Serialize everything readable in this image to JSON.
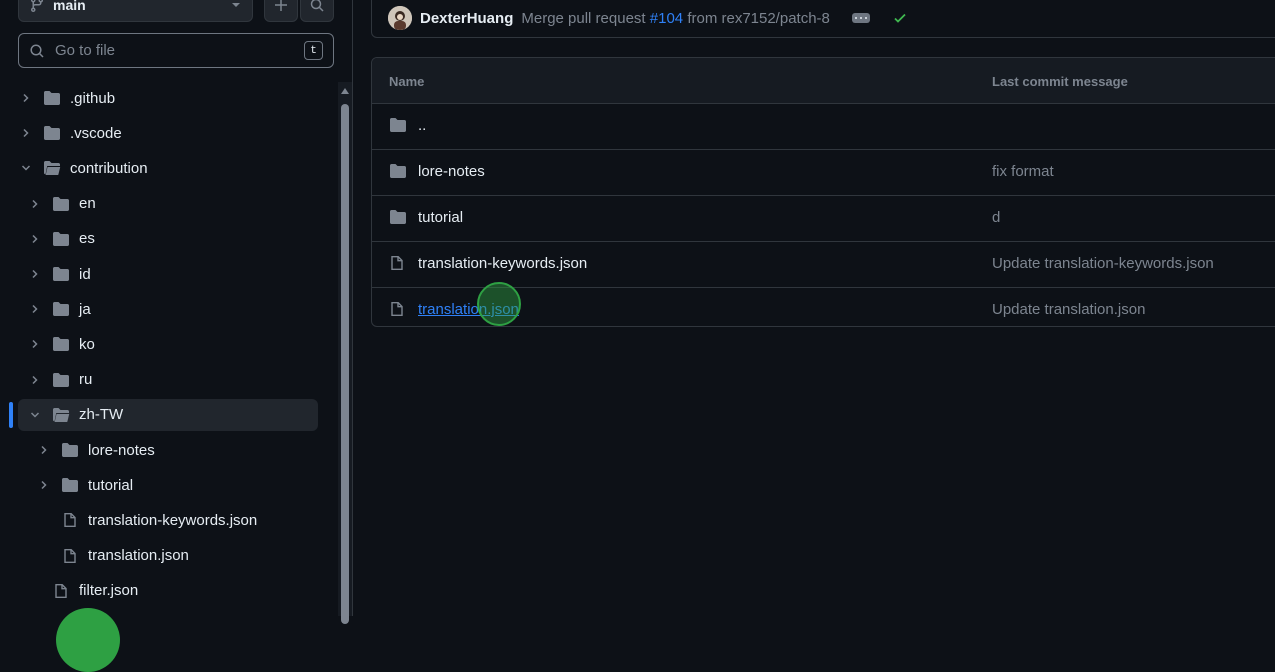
{
  "branch": {
    "name": "main"
  },
  "search": {
    "placeholder": "Go to file",
    "shortcut": "t"
  },
  "tree": [
    {
      "label": ".github",
      "type": "folder",
      "expanded": false,
      "level": 0
    },
    {
      "label": ".vscode",
      "type": "folder",
      "expanded": false,
      "level": 0
    },
    {
      "label": "contribution",
      "type": "folder",
      "expanded": true,
      "level": 0
    },
    {
      "label": "en",
      "type": "folder",
      "expanded": false,
      "level": 1
    },
    {
      "label": "es",
      "type": "folder",
      "expanded": false,
      "level": 1
    },
    {
      "label": "id",
      "type": "folder",
      "expanded": false,
      "level": 1
    },
    {
      "label": "ja",
      "type": "folder",
      "expanded": false,
      "level": 1
    },
    {
      "label": "ko",
      "type": "folder",
      "expanded": false,
      "level": 1
    },
    {
      "label": "ru",
      "type": "folder",
      "expanded": false,
      "level": 1
    },
    {
      "label": "zh-TW",
      "type": "folder",
      "expanded": true,
      "level": 1,
      "active": true
    },
    {
      "label": "lore-notes",
      "type": "folder",
      "expanded": false,
      "level": 2
    },
    {
      "label": "tutorial",
      "type": "folder",
      "expanded": false,
      "level": 2
    },
    {
      "label": "translation-keywords.json",
      "type": "file",
      "level": 2
    },
    {
      "label": "translation.json",
      "type": "file",
      "level": 2
    },
    {
      "label": "filter.json",
      "type": "file",
      "level": 1
    }
  ],
  "commit": {
    "author": "DexterHuang",
    "message_prefix": "Merge pull request",
    "pr_link": "#104",
    "message_suffix": "from rex7152/patch-8",
    "status": "success"
  },
  "table": {
    "headers": {
      "name": "Name",
      "message": "Last commit message"
    },
    "rows": [
      {
        "name": "..",
        "type": "folder",
        "message": ""
      },
      {
        "name": "lore-notes",
        "type": "folder",
        "message": "fix format"
      },
      {
        "name": "tutorial",
        "type": "folder",
        "message": "d"
      },
      {
        "name": "translation-keywords.json",
        "type": "file",
        "message": "Update translation-keywords.json"
      },
      {
        "name": "translation.json",
        "type": "file",
        "message": "Update translation.json",
        "hovered": true
      }
    ]
  },
  "colors": {
    "background": "#0d1117",
    "accent": "#2f81f7",
    "success": "#3fb950",
    "muted": "#7d8590"
  }
}
